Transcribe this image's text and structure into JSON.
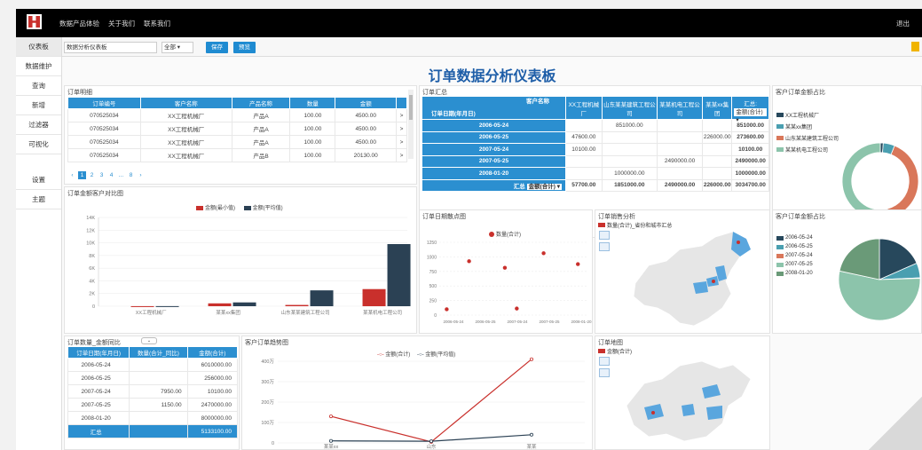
{
  "topbar": {
    "nav": [
      "数据产品体验",
      "关于我们",
      "联系我们"
    ],
    "exit": "退出"
  },
  "left_menu": [
    "仪表板",
    "数据维护",
    "查询",
    "新增",
    "过滤器",
    "可视化",
    "设置",
    "主题"
  ],
  "toolbar": {
    "input_value": "数据分析仪表板",
    "select_value": "全部",
    "btn1": "保存",
    "btn2": "预览"
  },
  "dashboard": {
    "title": "订单数据分析仪表板"
  },
  "orders_table": {
    "title": "订单明细",
    "headers": [
      "订单编号",
      "客户名称",
      "产品名称",
      "数量",
      "金额"
    ],
    "rows": [
      [
        "070525034",
        "XX工程机械厂",
        "产品A",
        "100.00",
        "4500.00",
        ">"
      ],
      [
        "070525034",
        "XX工程机械厂",
        "产品A",
        "100.00",
        "4500.00",
        ">"
      ],
      [
        "070525034",
        "XX工程机械厂",
        "产品A",
        "100.00",
        "4500.00",
        ">"
      ],
      [
        "070525034",
        "XX工程机械厂",
        "产品B",
        "100.00",
        "20130.00",
        ">"
      ]
    ],
    "pager": [
      "‹",
      "1",
      "2",
      "3",
      "4",
      "...",
      "8",
      "›"
    ]
  },
  "pivot_table": {
    "title": "订单汇总",
    "corner_top": "客户名称",
    "corner_left": "订单日期(年月日)",
    "col_headers": [
      "XX工程机械厂",
      "山东某某建筑工程公司",
      "某某机电工程公司",
      "某某xx集团"
    ],
    "total_label": "汇总:",
    "total_select": "金额(合计)",
    "rows": [
      {
        "date": "2006-05-24",
        "vals": [
          "",
          "851000.00",
          "",
          "",
          "851000.00"
        ]
      },
      {
        "date": "2006-05-25",
        "vals": [
          "47600.00",
          "",
          "",
          "226000.00",
          "273600.00"
        ]
      },
      {
        "date": "2007-05-24",
        "vals": [
          "10100.00",
          "",
          "",
          "",
          "10100.00"
        ]
      },
      {
        "date": "2007-05-25",
        "vals": [
          "",
          "",
          "2490000.00",
          "",
          "2490000.00"
        ]
      },
      {
        "date": "2008-01-20",
        "vals": [
          "",
          "1000000.00",
          "",
          "",
          "1000000.00"
        ]
      }
    ],
    "sum_label": "汇总",
    "sum_select": "金额(合计)",
    "sum_vals": [
      "57700.00",
      "1851000.00",
      "2490000.00",
      "226000.00",
      "3034700.00"
    ]
  },
  "donut": {
    "title": "客户订单金额占比",
    "legend": [
      "XX工程机械厂",
      "某某xx集团",
      "山东某某建筑工程公司",
      "某某机电工程公司"
    ],
    "colors": [
      "#27485c",
      "#4a9fb0",
      "#d9775a",
      "#8cc4ab"
    ],
    "values": [
      57700,
      226000,
      1851000,
      2490000
    ]
  },
  "bar_chart": {
    "title": "订单金额客户对比图",
    "legend": [
      "金额(最小值)",
      "金额(平均值)"
    ],
    "colors": [
      "#c9302c",
      "#2b4154"
    ],
    "chart_data": {
      "type": "bar",
      "categories": [
        "XX工程机械厂",
        "某某xx集团",
        "山东某某建筑工程公司",
        "某某机电工程公司"
      ],
      "series": [
        {
          "name": "金额(最小值)",
          "values": [
            1000,
            45000,
            20000,
            270000
          ]
        },
        {
          "name": "金额(平均值)",
          "values": [
            1500,
            60000,
            250000,
            980000
          ]
        }
      ],
      "y_ticks": [
        "0",
        "2K",
        "4K",
        "6K",
        "8K",
        "10K",
        "12K",
        "14K"
      ],
      "ylim": [
        0,
        1400000
      ]
    }
  },
  "scatter": {
    "title": "订单日期散点图",
    "legend": "数量(合计)",
    "color": "#c9302c",
    "chart_data": {
      "type": "scatter",
      "x_labels": [
        "2006-05-24",
        "2006-05-25",
        "2007-05-24",
        "2007-05-25",
        "2008-01-20"
      ],
      "points": [
        [
          0.05,
          0.92
        ],
        [
          0.2,
          0.26
        ],
        [
          0.44,
          0.35
        ],
        [
          0.52,
          0.91
        ],
        [
          0.7,
          0.15
        ],
        [
          0.93,
          0.3
        ]
      ],
      "y_ticks": [
        "0",
        "250",
        "500",
        "750",
        "1000",
        "1250"
      ]
    }
  },
  "map1": {
    "title": "订单销售分析",
    "legend": "数量(合计)_省份和城市汇总"
  },
  "pie": {
    "title": "客户订单金额占比",
    "legend": [
      "2006-05-24",
      "2006-05-25",
      "2007-05-24",
      "2007-05-25",
      "2008-01-20"
    ],
    "colors": [
      "#27485c",
      "#4a9fb0",
      "#d9775a",
      "#8cc4ab",
      "#6a9a78"
    ],
    "values": [
      851000,
      273600,
      10100,
      2490000,
      1000000
    ]
  },
  "small_table": {
    "title": "订单数量_金额同比",
    "headers": [
      "订单日期(年月日)",
      "数量(合计_同比)",
      "金额(合计)"
    ],
    "rows": [
      [
        "2006-05-24",
        "",
        "6010000.00"
      ],
      [
        "2006-05-25",
        "",
        "256000.00"
      ],
      [
        "2007-05-24",
        "7950.00",
        "10100.00"
      ],
      [
        "2007-05-25",
        "1150.00",
        "2470000.00"
      ],
      [
        "2008-01-20",
        "",
        "8000000.00"
      ]
    ],
    "total": [
      "汇总",
      "",
      "5133100.00"
    ]
  },
  "line_chart": {
    "title": "客户订单趋势图",
    "legend": [
      "金额(合计)",
      "金额(平均值)"
    ],
    "colors": [
      "#c9302c",
      "#2b4154"
    ],
    "chart_data": {
      "type": "line",
      "categories": [
        "某某xx",
        "山东",
        "某某"
      ],
      "series": [
        {
          "name": "金额(合计)",
          "values": [
            130,
            5,
            410
          ]
        },
        {
          "name": "金额(平均值)",
          "values": [
            10,
            8,
            40
          ]
        }
      ],
      "y_ticks": [
        "0",
        "100万",
        "200万",
        "300万",
        "400万"
      ],
      "ylim": [
        0,
        400
      ]
    }
  },
  "map2": {
    "title": "订单地图",
    "legend": "金额(合计)"
  }
}
